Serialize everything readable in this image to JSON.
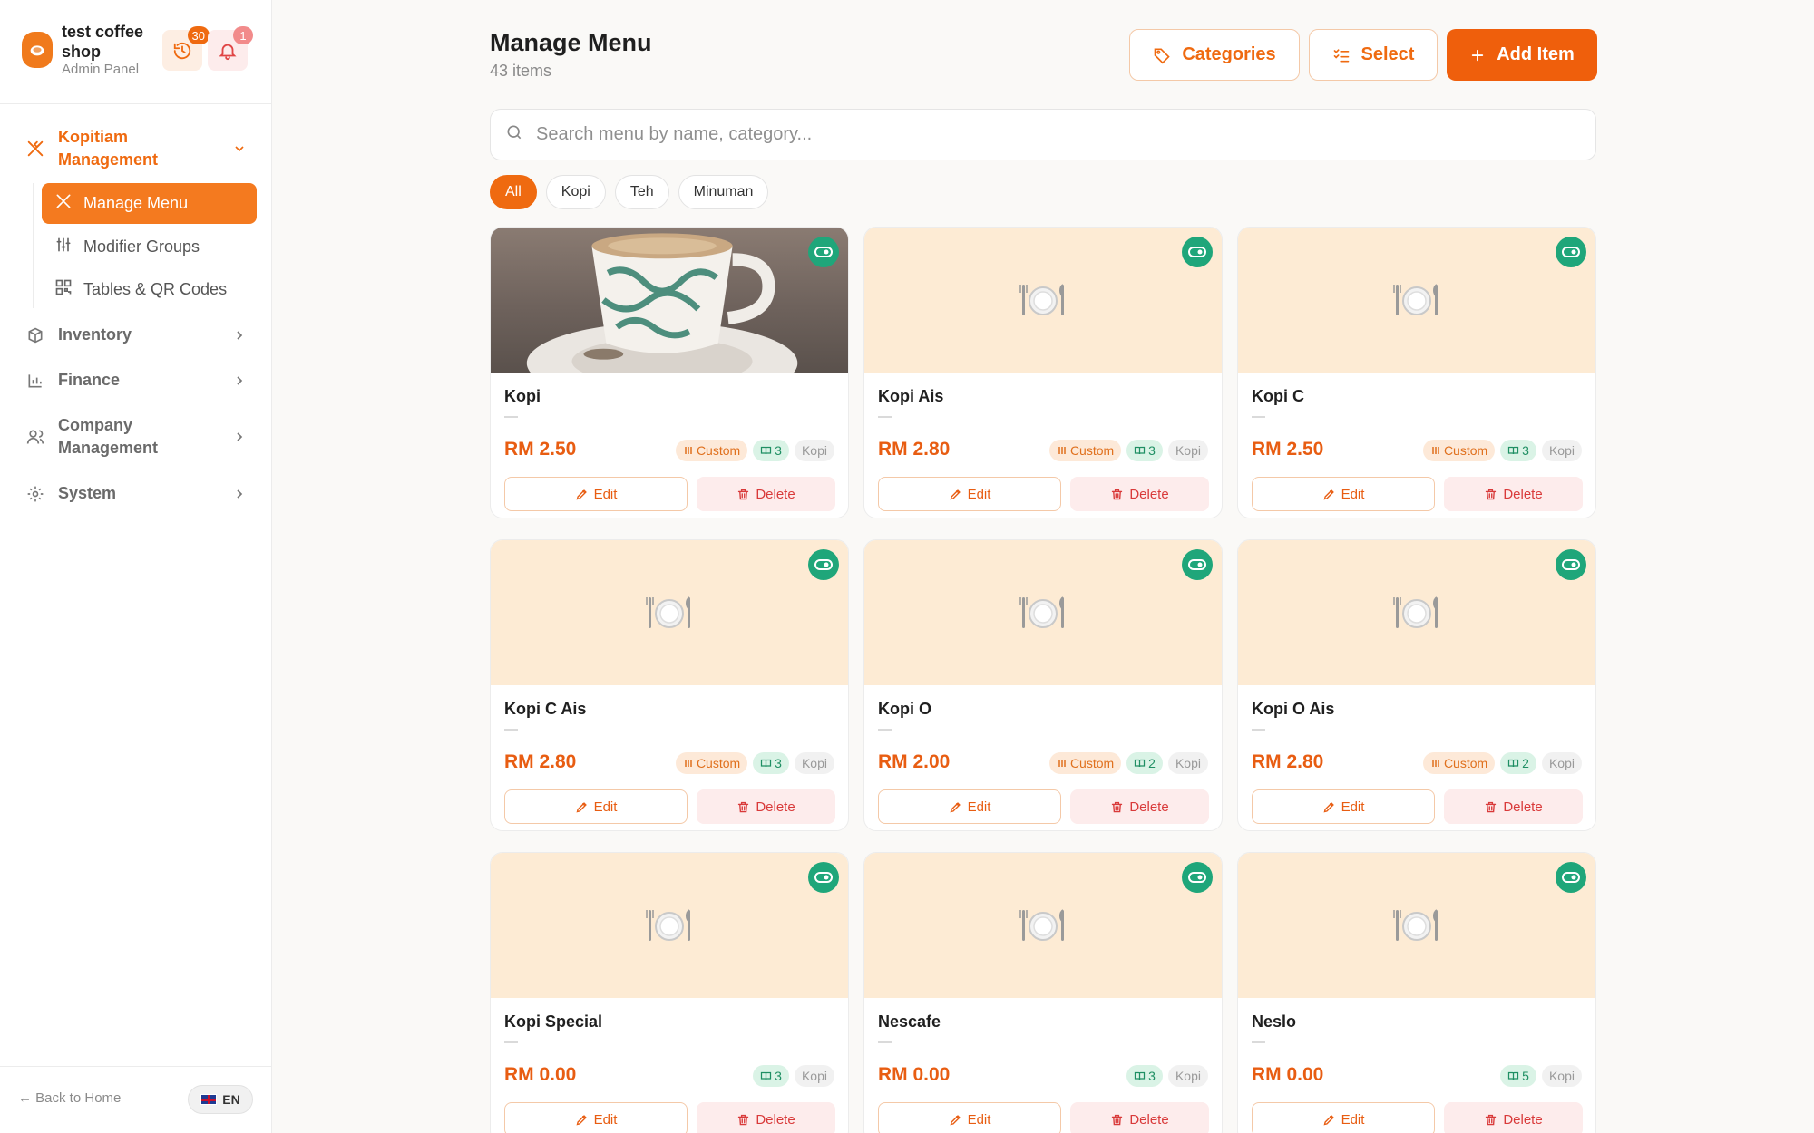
{
  "brand": {
    "name": "test coffee shop",
    "subtitle": "Admin Panel"
  },
  "header": {
    "history_count": "30",
    "notification_count": "1"
  },
  "sidebar": {
    "groups": [
      {
        "label": "Kopitiam Management",
        "expanded": true
      },
      {
        "label": "Inventory"
      },
      {
        "label": "Finance"
      },
      {
        "label": "Company Management"
      },
      {
        "label": "System"
      }
    ],
    "sub_items": [
      {
        "label": "Manage Menu",
        "active": true
      },
      {
        "label": "Modifier Groups"
      },
      {
        "label": "Tables & QR Codes"
      }
    ],
    "back_label": "← Back to Home",
    "language": "EN"
  },
  "main": {
    "title": "Manage Menu",
    "count": "43 items",
    "buttons": {
      "categories": "Categories",
      "select": "Select",
      "add": "Add Item"
    },
    "search_placeholder": "Search menu by name, category...",
    "filters": [
      "All",
      "Kopi",
      "Teh",
      "Minuman"
    ],
    "active_filter": "All"
  },
  "card_labels": {
    "edit": "Edit",
    "delete": "Delete",
    "custom": "Custom",
    "dash": "—"
  },
  "items": [
    {
      "name": "Kopi",
      "price": "RM 2.50",
      "custom": true,
      "modifiers": "3",
      "category": "Kopi",
      "has_photo": true,
      "available": true
    },
    {
      "name": "Kopi Ais",
      "price": "RM 2.80",
      "custom": true,
      "modifiers": "3",
      "category": "Kopi",
      "has_photo": false,
      "available": true
    },
    {
      "name": "Kopi C",
      "price": "RM 2.50",
      "custom": true,
      "modifiers": "3",
      "category": "Kopi",
      "has_photo": false,
      "available": true
    },
    {
      "name": "Kopi C Ais",
      "price": "RM 2.80",
      "custom": true,
      "modifiers": "3",
      "category": "Kopi",
      "has_photo": false,
      "available": true
    },
    {
      "name": "Kopi O",
      "price": "RM 2.00",
      "custom": true,
      "modifiers": "2",
      "category": "Kopi",
      "has_photo": false,
      "available": true
    },
    {
      "name": "Kopi O Ais",
      "price": "RM 2.80",
      "custom": true,
      "modifiers": "2",
      "category": "Kopi",
      "has_photo": false,
      "available": true
    },
    {
      "name": "Kopi Special",
      "price": "RM 0.00",
      "custom": false,
      "modifiers": "3",
      "category": "Kopi",
      "has_photo": false,
      "available": true
    },
    {
      "name": "Nescafe",
      "price": "RM 0.00",
      "custom": false,
      "modifiers": "3",
      "category": "Kopi",
      "has_photo": false,
      "available": true
    },
    {
      "name": "Neslo",
      "price": "RM 0.00",
      "custom": false,
      "modifiers": "5",
      "category": "Kopi",
      "has_photo": false,
      "available": true
    }
  ],
  "colors": {
    "accent": "#ef6a10",
    "available": "#1fa67a",
    "danger": "#d93a3a",
    "placeholder_bg": "#fdebd4"
  },
  "icons": {
    "placeholder": "plate-cutlery-icon"
  }
}
